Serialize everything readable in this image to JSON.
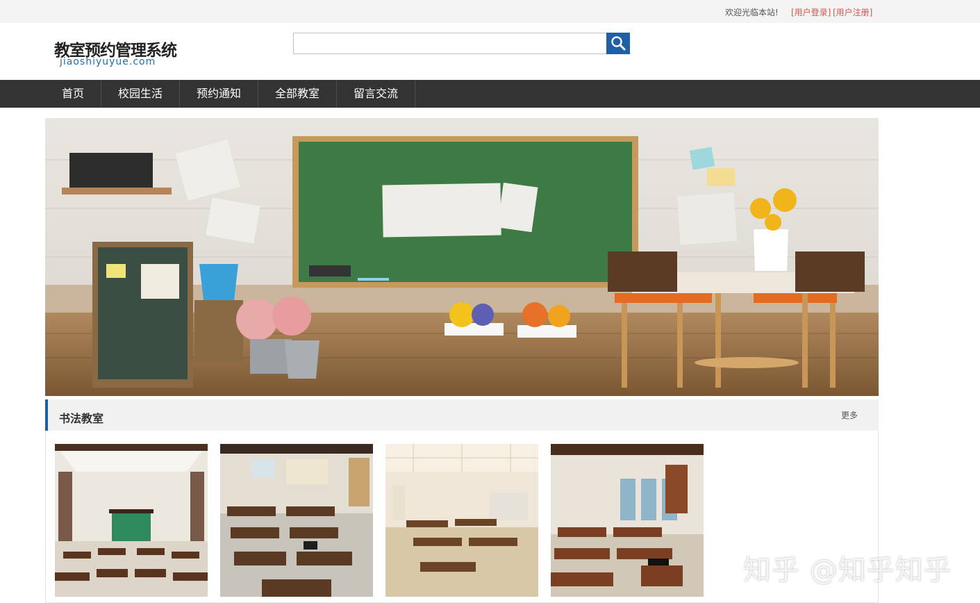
{
  "topbar": {
    "welcome": "欢迎光临本站!",
    "login": "[用户登录]",
    "register": "[用户注册]"
  },
  "header": {
    "title": "教室预约管理系统",
    "subtitle": "jiaoshiyuyue.com",
    "search_placeholder": ""
  },
  "nav": {
    "items": [
      "首页",
      "校园生活",
      "预约通知",
      "全部教室",
      "留言交流"
    ]
  },
  "section": {
    "title": "书法教室",
    "more": "更多"
  },
  "watermark": "知乎 @知乎知乎",
  "colors": {
    "accent": "#1f5fa8",
    "nav_bg": "#333333",
    "link": "#d9534f"
  }
}
